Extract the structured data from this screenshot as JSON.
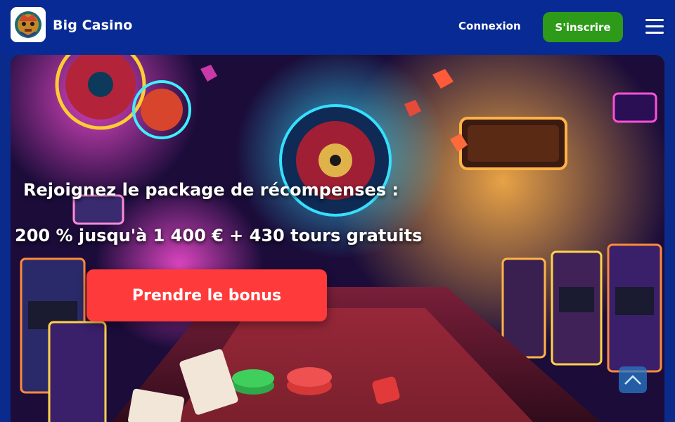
{
  "header": {
    "brand": "Big Casino",
    "login_label": "Connexion",
    "signup_label": "S'inscrire",
    "menu_icon": "hamburger-menu-icon",
    "logo_icon": "casino-mask-logo-icon"
  },
  "hero": {
    "line1": "Rejoignez le package de récompenses :",
    "line2": "200 % jusqu'à 1 400 € + 430 tours gratuits",
    "button_label": "Prendre le bonus",
    "background_image": "neon-casino-hall-illustration",
    "scroll_icon": "chevron-up-icon"
  },
  "colors": {
    "header_bg": "#082a94",
    "signup_green": "#2e9a19",
    "bonus_red": "#ff3a3a",
    "text_white": "#ffffff"
  }
}
